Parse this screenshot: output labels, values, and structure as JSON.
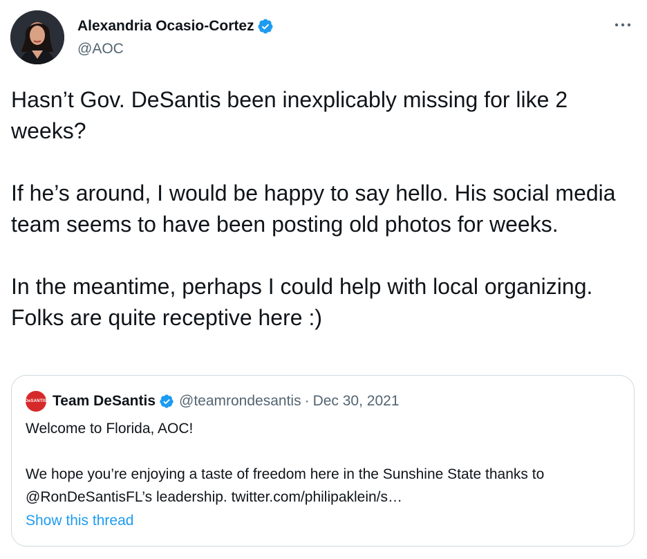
{
  "author": {
    "name": "Alexandria Ocasio-Cortez",
    "handle": "@AOC",
    "verified_icon": "verified-badge-icon",
    "accent": "#1d9bf0"
  },
  "tweet": {
    "paragraphs": [
      "Hasn’t Gov. DeSantis been inexplicably missing for like 2 weeks?",
      "If he’s around, I would be happy to say hello. His social media team seems to have been posting old photos for weeks.",
      "In the meantime, perhaps I could help with local organizing. Folks are quite receptive here :)"
    ]
  },
  "more_icon": "ellipsis-icon",
  "quote": {
    "avatar_text": "DeSANTIS",
    "avatar_color": "#d62a2a",
    "name": "Team DeSantis",
    "handle": "@teamrondesantis",
    "separator": "·",
    "date": "Dec 30, 2021",
    "paragraphs": [
      "Welcome to Florida, AOC!",
      "We hope you’re enjoying a taste of freedom here in the Sunshine State thanks to @RonDeSantisFL’s leadership. twitter.com/philipaklein/s…"
    ],
    "show_thread": "Show this thread"
  }
}
